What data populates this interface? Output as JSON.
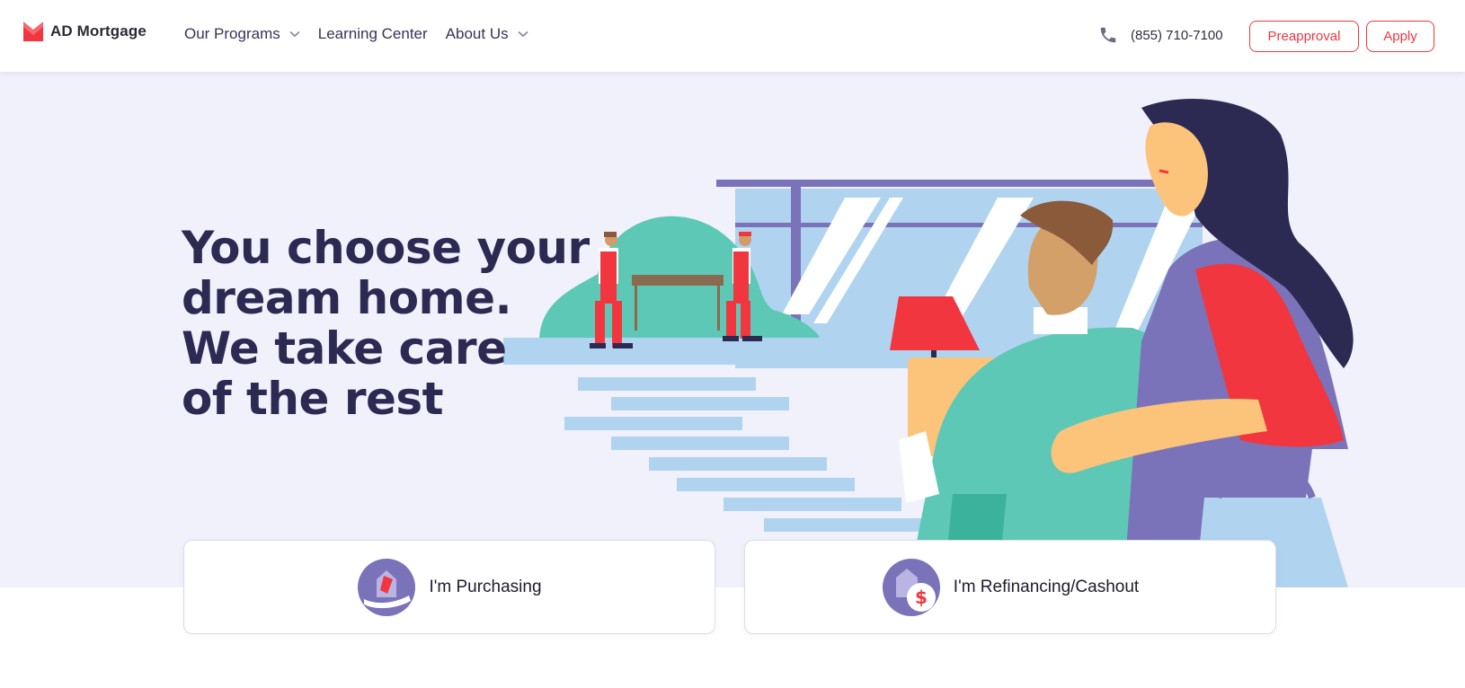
{
  "header": {
    "logo_text": "AD Mortgage",
    "nav": [
      {
        "label": "Our Programs",
        "has_dropdown": true
      },
      {
        "label": "Learning Center",
        "has_dropdown": false
      },
      {
        "label": "About Us",
        "has_dropdown": true
      }
    ],
    "phone": "(855) 710-7100",
    "preapproval_label": "Preapproval",
    "apply_label": "Apply"
  },
  "hero": {
    "title_lines": [
      "You choose your",
      "dream home.",
      "We take care",
      "of the rest"
    ]
  },
  "cards": [
    {
      "label": "I'm Purchasing",
      "icon": "house-in-hand-icon"
    },
    {
      "label": "I'm Refinancing/Cashout",
      "icon": "house-dollar-icon"
    }
  ],
  "colors": {
    "accent": "#f2363f",
    "navy": "#2c2a52",
    "hero_bg": "#f1f1fb",
    "purple": "#7a73b9",
    "teal": "#5ec8b6",
    "sky": "#b0d4ef"
  }
}
